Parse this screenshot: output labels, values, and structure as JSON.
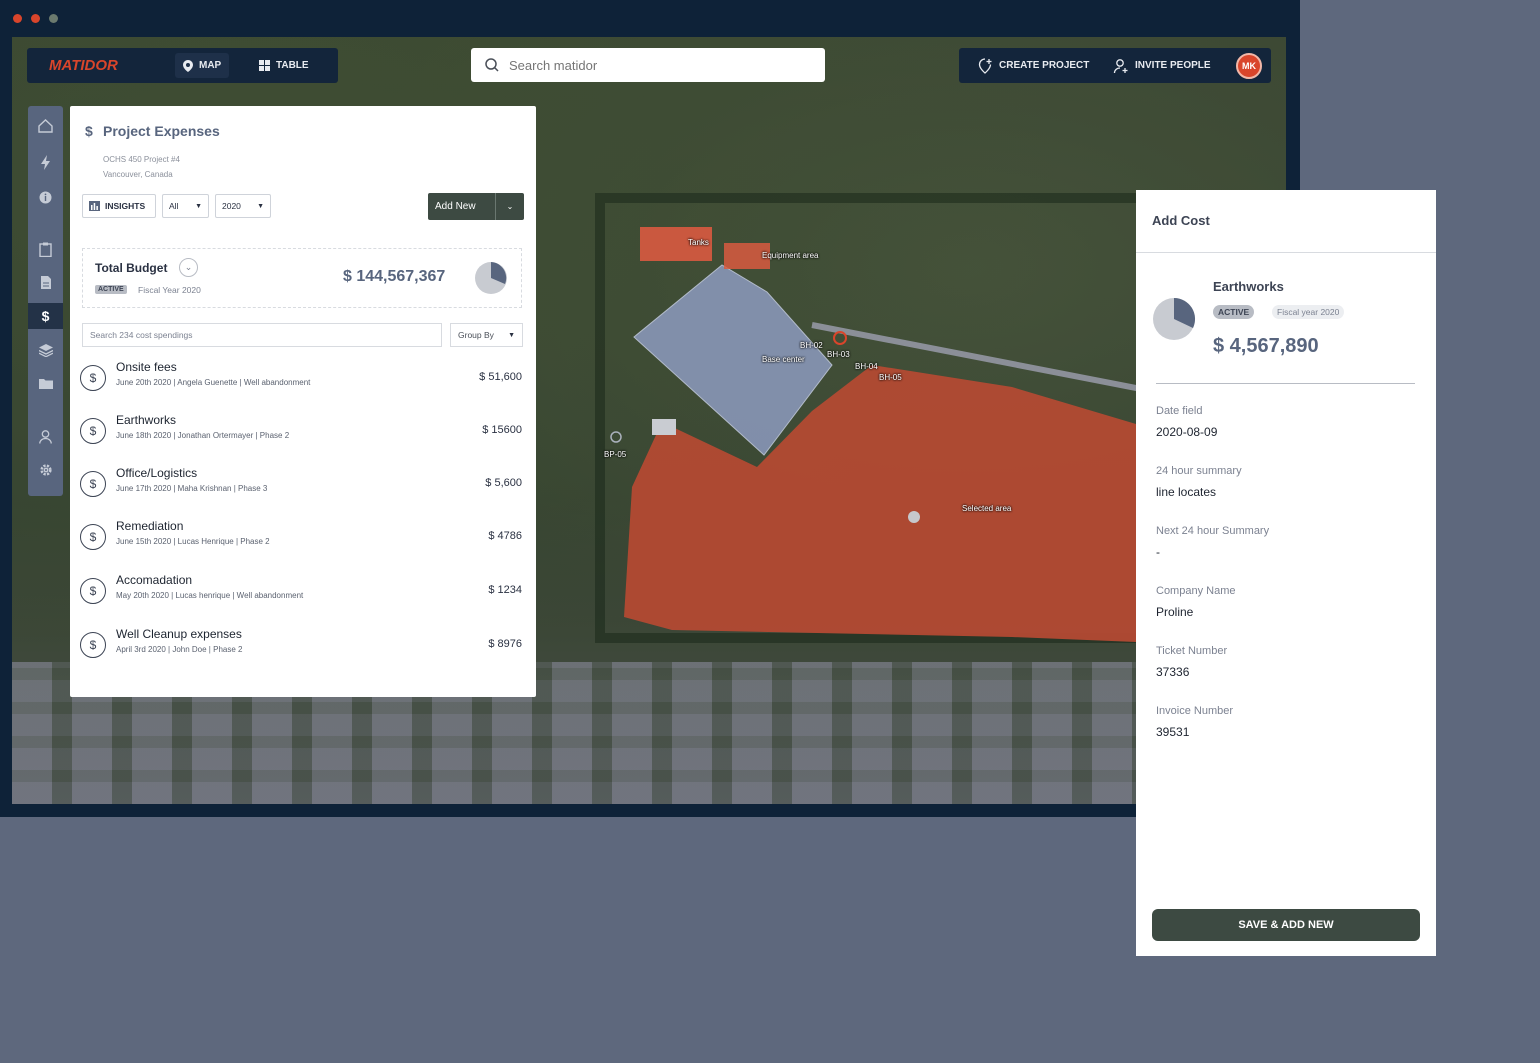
{
  "app": {
    "logo": "MATIDOR"
  },
  "nav": {
    "map_label": "MAP",
    "table_label": "TABLE",
    "search_placeholder": "Search matidor",
    "create_project_label": "CREATE PROJECT",
    "invite_people_label": "INVITE PEOPLE",
    "avatar_initials": "MK"
  },
  "sidebar": {
    "icons": [
      "home-icon",
      "lightning-icon",
      "info-icon",
      "clipboard-icon",
      "document-icon",
      "dollar-icon",
      "layers-icon",
      "folder-icon",
      "user-icon",
      "gear-icon"
    ],
    "active": "dollar-icon"
  },
  "expenses": {
    "title": "Project Expenses",
    "project_name": "OCHS 450 Project #4",
    "location": "Vancouver, Canada",
    "insights_label": "INSIGHTS",
    "filter_value": "All",
    "year_value": "2020",
    "add_new_label": "Add New",
    "budget": {
      "label": "Total Budget",
      "status": "ACTIVE",
      "period": "Fiscal Year 2020",
      "amount": "$ 144,567,367"
    },
    "search_placeholder": "Search 234 cost spendings",
    "group_by_label": "Group By",
    "items": [
      {
        "title": "Onsite fees",
        "meta": "June 20th 2020 | Angela Guenette  | Well abandonment",
        "amount": "$ 51,600"
      },
      {
        "title": "Earthworks",
        "meta": "June 18th 2020 | Jonathan Ortermayer | Phase 2",
        "amount": "$ 15600"
      },
      {
        "title": "Office/Logistics",
        "meta": "June 17th 2020 | Maha Krishnan | Phase 3",
        "amount": "$ 5,600"
      },
      {
        "title": "Remediation",
        "meta": "June 15th 2020 | Lucas Henrique | Phase 2",
        "amount": "$ 4786"
      },
      {
        "title": "Accomadation",
        "meta": "May 20th 2020 | Lucas henrique | Well abandonment",
        "amount": "$ 1234"
      },
      {
        "title": "Well Cleanup expenses",
        "meta": "April 3rd 2020 | John Doe | Phase 2",
        "amount": "$ 8976"
      }
    ]
  },
  "map": {
    "labels": {
      "tanks": "Tanks",
      "equipment": "Equipment area",
      "base_center": "Base center",
      "bh02": "BH-02",
      "bh03": "BH-03",
      "bh04": "BH-04",
      "bh05": "BH-05",
      "bp05": "BP-05",
      "selected": "Selected area"
    },
    "colors": {
      "selected_area": "#b34a33",
      "base_area": "#8d9bbf",
      "tanks": "#d95a40"
    }
  },
  "add_cost": {
    "title": "Add Cost",
    "item_title": "Earthworks",
    "status": "ACTIVE",
    "period": "Fiscal year 2020",
    "amount": "$ 4,567,890",
    "fields": [
      {
        "label": "Date field",
        "value": "2020-08-09"
      },
      {
        "label": "24 hour summary",
        "value": "line locates"
      },
      {
        "label": "Next 24 hour Summary",
        "value": "-"
      },
      {
        "label": "Company Name",
        "value": "Proline"
      },
      {
        "label": "Ticket Number",
        "value": "37336"
      },
      {
        "label": "Invoice Number",
        "value": "39531"
      }
    ],
    "save_label": "SAVE & ADD NEW"
  },
  "colors": {
    "accent": "#d9452b",
    "nav_bg": "#13253b",
    "window_bg": "#0e2238",
    "page_bg": "#5e687d",
    "button_dark": "#3d4a42"
  }
}
